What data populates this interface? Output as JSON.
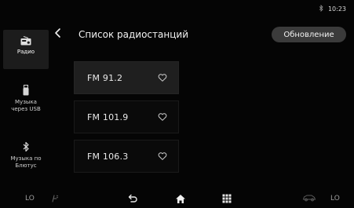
{
  "status": {
    "time": "10:23",
    "bluetooth_icon": "bluetooth-icon"
  },
  "header": {
    "title": "Список радиостанций",
    "update_button": "Обновление",
    "back_icon": "chevron-left-icon"
  },
  "sidebar": {
    "items": [
      {
        "label": "Радио",
        "icon": "radio-icon",
        "active": true
      },
      {
        "label": "Музыка через USB",
        "label_line1": "Музыка",
        "label_line2": "через USB",
        "icon": "usb-icon",
        "active": false
      },
      {
        "label": "Музыка по Блютус",
        "label_line1": "Музыка по",
        "label_line2": "Блютус",
        "icon": "bluetooth-icon",
        "active": false
      }
    ]
  },
  "stations": [
    {
      "freq": "FM 91.2",
      "favorite_icon": "heart-icon",
      "selected": true
    },
    {
      "freq": "FM 101.9",
      "favorite_icon": "heart-icon",
      "selected": false
    },
    {
      "freq": "FM 106.3",
      "favorite_icon": "heart-icon",
      "selected": false
    }
  ],
  "bottom_bar": {
    "left_temp": "LO",
    "right_temp": "LO",
    "icons": [
      "seat-fan-icon",
      "back-icon",
      "home-icon",
      "grid-icon",
      "car-icon"
    ]
  },
  "colors": {
    "background": "#050505",
    "active_item": "#1f1f1f",
    "button": "#3b3b3b",
    "text": "#e6e6e6"
  }
}
